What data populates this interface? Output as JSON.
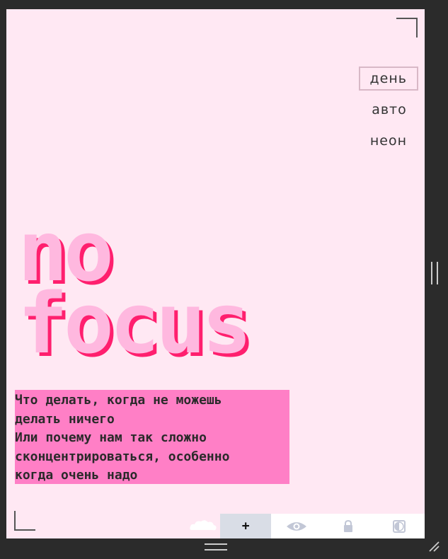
{
  "themes": [
    {
      "label": "день",
      "active": true
    },
    {
      "label": "авто",
      "active": false
    },
    {
      "label": "неон",
      "active": false
    }
  ],
  "title": {
    "line1": "no",
    "line2": "focus"
  },
  "subtitle": {
    "lines": [
      "Что делать, когда не можешь",
      "делать ничего",
      "Или почему нам так сложно",
      "сконцентрироваться, особенно",
      "когда очень надо"
    ]
  },
  "toolbar": {
    "add_icon": "plus-icon",
    "preview_icon": "eye-icon",
    "lock_icon": "lock-icon",
    "contrast_icon": "contrast-icon"
  },
  "colors": {
    "background": "#ffe8f3",
    "title_fill": "#ffb8df",
    "title_shadow": "#ff1f6e",
    "subtitle_bg": "#ff7fc6"
  }
}
